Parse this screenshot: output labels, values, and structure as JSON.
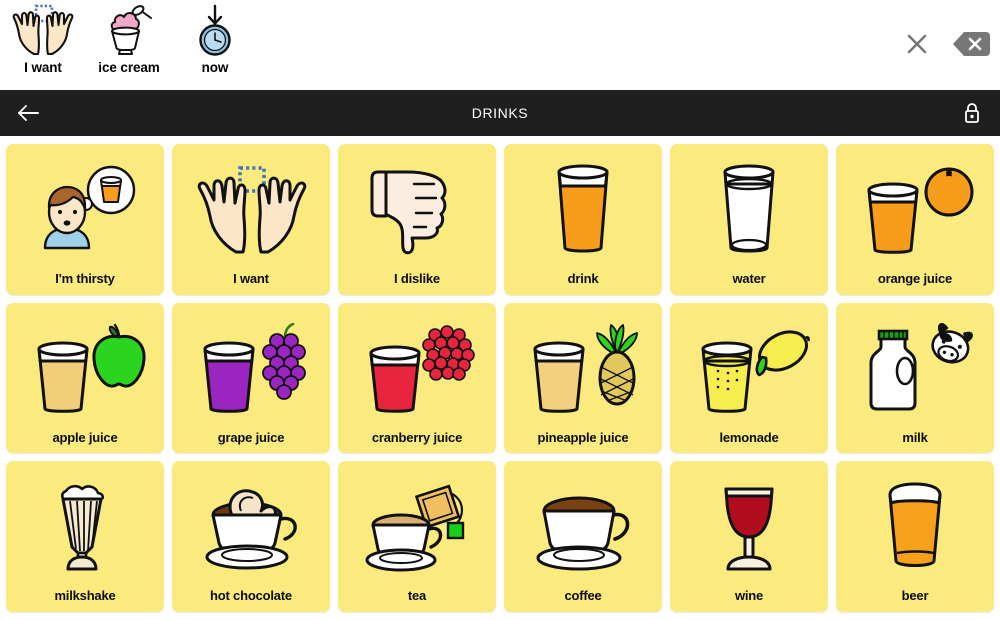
{
  "sentence_bar": {
    "items": [
      {
        "label": "I want",
        "icon": "hands-wanting-icon"
      },
      {
        "label": "ice cream",
        "icon": "ice-cream-sundae-icon"
      },
      {
        "label": "now",
        "icon": "clock-down-arrow-icon"
      }
    ],
    "controls": [
      {
        "name": "clear-sentence-button",
        "icon": "close-x-icon",
        "label": ""
      },
      {
        "name": "backspace-button",
        "icon": "backspace-delete-icon",
        "label": ""
      }
    ]
  },
  "header": {
    "back_icon": "back-arrow-icon",
    "title": "DRINKS",
    "lock_icon": "lock-closed-icon"
  },
  "board": {
    "columns": 6,
    "rows": 3,
    "cell_color": "#fbeb7e",
    "cells": [
      {
        "label": "I'm thirsty",
        "icon": "person-thinking-drink-icon"
      },
      {
        "label": "I want",
        "icon": "hands-wanting-icon"
      },
      {
        "label": "I dislike",
        "icon": "thumbs-down-icon"
      },
      {
        "label": "drink",
        "icon": "glass-orange-drink-icon"
      },
      {
        "label": "water",
        "icon": "glass-water-icon"
      },
      {
        "label": "orange juice",
        "icon": "glass-orange-juice-icon"
      },
      {
        "label": "apple juice",
        "icon": "glass-apple-juice-icon"
      },
      {
        "label": "grape juice",
        "icon": "glass-grape-juice-icon"
      },
      {
        "label": "cranberry juice",
        "icon": "glass-cranberry-juice-icon"
      },
      {
        "label": "pineapple juice",
        "icon": "glass-pineapple-juice-icon"
      },
      {
        "label": "lemonade",
        "icon": "glass-lemonade-icon"
      },
      {
        "label": "milk",
        "icon": "milk-jug-cow-icon"
      },
      {
        "label": "milkshake",
        "icon": "milkshake-glass-icon"
      },
      {
        "label": "hot chocolate",
        "icon": "hot-chocolate-cup-icon"
      },
      {
        "label": "tea",
        "icon": "teacup-teabag-icon"
      },
      {
        "label": "coffee",
        "icon": "coffee-cup-icon"
      },
      {
        "label": "wine",
        "icon": "wine-glass-icon"
      },
      {
        "label": "beer",
        "icon": "beer-pint-icon"
      }
    ]
  },
  "colors": {
    "header_bg": "#1f1f1f",
    "cell_bg": "#fbeb7e",
    "page_bg": "#ffffff",
    "orange": "#f89c1c",
    "water": "#ffffff",
    "apple_juice": "#f2ce7a",
    "grape": "#9b25c1",
    "cranberry": "#e8243f",
    "pineapple": "#f3d080",
    "lemonade": "#f5ee4e",
    "milk": "#ffffff",
    "chocolate": "#6b3a14",
    "coffee": "#7a4112",
    "wine": "#b00d1e",
    "beer": "#f6a01c"
  }
}
